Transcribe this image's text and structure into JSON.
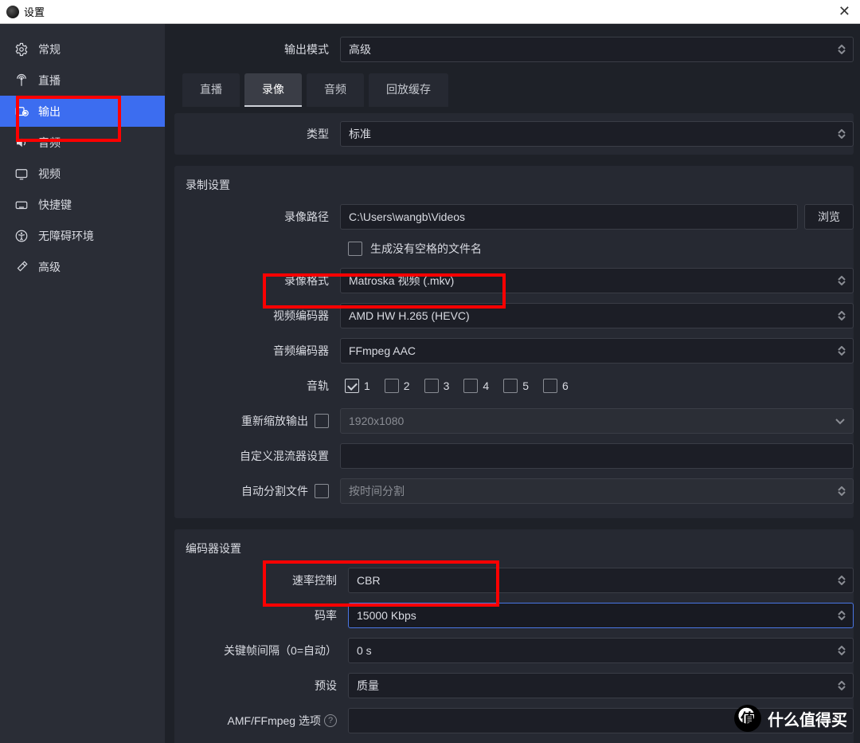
{
  "window": {
    "title": "设置"
  },
  "sidebar": {
    "items": [
      {
        "label": "常规"
      },
      {
        "label": "直播"
      },
      {
        "label": "输出"
      },
      {
        "label": "音频"
      },
      {
        "label": "视频"
      },
      {
        "label": "快捷键"
      },
      {
        "label": "无障碍环境"
      },
      {
        "label": "高级"
      }
    ]
  },
  "output_mode": {
    "label": "输出模式",
    "value": "高级"
  },
  "tabs": [
    {
      "label": "直播"
    },
    {
      "label": "录像"
    },
    {
      "label": "音频"
    },
    {
      "label": "回放缓存"
    }
  ],
  "type": {
    "label": "类型",
    "value": "标准"
  },
  "recording": {
    "title": "录制设置",
    "path_label": "录像路径",
    "path_value": "C:\\Users\\wangb\\Videos",
    "browse": "浏览",
    "no_space_label": "生成没有空格的文件名",
    "format_label": "录像格式",
    "format_value": "Matroska 视频 (.mkv)",
    "video_encoder_label": "视频编码器",
    "video_encoder_value": "AMD HW H.265 (HEVC)",
    "audio_encoder_label": "音频编码器",
    "audio_encoder_value": "FFmpeg AAC",
    "tracks_label": "音轨",
    "tracks": [
      "1",
      "2",
      "3",
      "4",
      "5",
      "6"
    ],
    "rescale_label": "重新缩放输出",
    "rescale_value": "1920x1080",
    "muxer_label": "自定义混流器设置",
    "split_label": "自动分割文件",
    "split_value": "按时间分割"
  },
  "encoder": {
    "title": "编码器设置",
    "rate_label": "速率控制",
    "rate_value": "CBR",
    "bitrate_label": "码率",
    "bitrate_value": "15000 Kbps",
    "keyframe_label": "关键帧间隔（0=自动）",
    "keyframe_value": "0 s",
    "preset_label": "预设",
    "preset_value": "质量",
    "amf_label": "AMF/FFmpeg 选项"
  },
  "watermark": {
    "text": "什么值得买",
    "char": "值"
  }
}
